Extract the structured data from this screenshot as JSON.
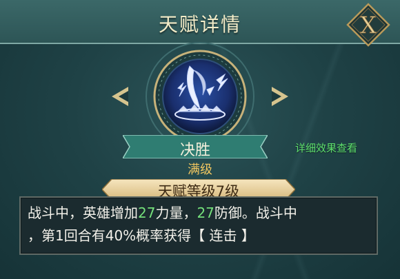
{
  "header": {
    "title": "天赋详情"
  },
  "close_button": {
    "label": "X"
  },
  "talent": {
    "name": "决胜",
    "max_level_text": "满级",
    "level_label": "天赋等级7级"
  },
  "detail_link": "详细效果查看",
  "description": {
    "seg1": "战斗中，英雄增加",
    "val1": "27",
    "seg2": "力量，",
    "val2": "27",
    "seg3": "防御。战斗中",
    "line2": "，第1回合有40%概率获得【 连击 】"
  },
  "colors": {
    "highlight": "#74e07b",
    "link": "#5ee06e",
    "max_level": "#f1c660",
    "title": "#f3ecc8"
  }
}
